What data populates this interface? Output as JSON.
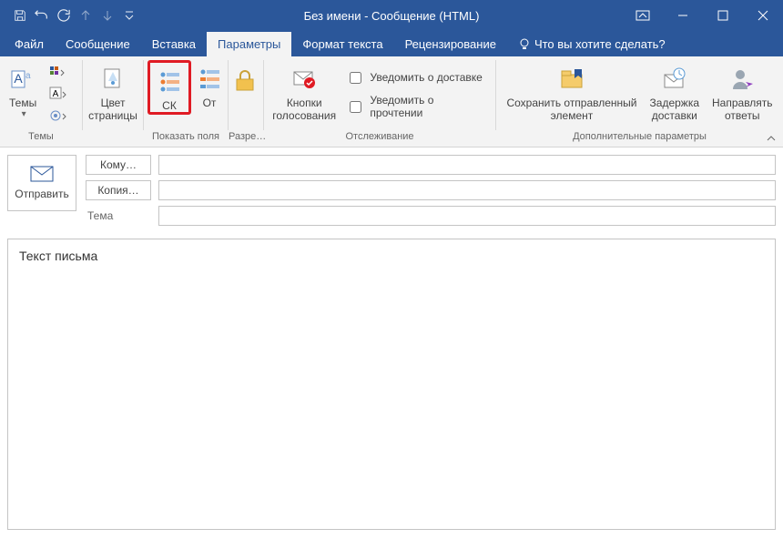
{
  "title": "Без имени - Сообщение (HTML)",
  "tabs": {
    "file": "Файл",
    "message": "Сообщение",
    "insert": "Вставка",
    "options": "Параметры",
    "format": "Формат текста",
    "review": "Рецензирование"
  },
  "tellme": "Что вы хотите сделать?",
  "groups": {
    "themes": {
      "label": "Темы",
      "themes_btn": "Темы",
      "page_color": "Цвет\nстраницы"
    },
    "show_fields": {
      "label": "Показать поля",
      "bcc": "СК",
      "from": "От"
    },
    "permissions": {
      "label": "Разре…"
    },
    "tracking": {
      "label": "Отслеживание",
      "voting": "Кнопки\nголосования",
      "delivery_receipt": "Уведомить о доставке",
      "read_receipt": "Уведомить о прочтении"
    },
    "more": {
      "label": "Дополнительные параметры",
      "save_sent": "Сохранить отправленный\nэлемент",
      "delay": "Задержка\nдоставки",
      "direct_replies": "Направлять\nответы"
    }
  },
  "compose": {
    "send": "Отправить",
    "to": "Кому…",
    "cc": "Копия…",
    "subject_label": "Тема",
    "body": "Текст письма"
  }
}
